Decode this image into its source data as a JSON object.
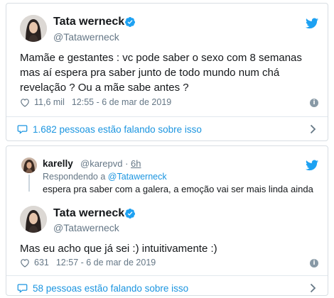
{
  "colors": {
    "link": "#1b95e0",
    "twitter_blue": "#1da1f2",
    "muted": "#657786",
    "text": "#14171a"
  },
  "tweet1": {
    "author_name": "Tata werneck",
    "author_handle": "@Tatawerneck",
    "text": "Mamãe e gestantes : vc pode saber o sexo com 8 semanas mas aí espera pra saber junto de todo mundo num chá revelação ? Ou a mãe sabe antes ?",
    "likes": "11,6 mil",
    "timestamp": "12:55 - 6 de mar de 2019",
    "talking": "1.682 pessoas estão falando sobre isso"
  },
  "reply_context": {
    "author_name": "karelly",
    "author_handle": "@karepvd",
    "time_ago": "6h",
    "replying_prefix": "Respondendo a",
    "replying_to": "@Tatawerneck",
    "text": "espera pra saber com a galera, a emoção vai ser mais linda ainda"
  },
  "tweet2": {
    "author_name": "Tata werneck",
    "author_handle": "@Tatawerneck",
    "text": "Mas eu acho que já sei :) intuitivamente :)",
    "likes": "631",
    "timestamp": "12:57 - 6 de mar de 2019",
    "talking": "58 pessoas estão falando sobre isso"
  },
  "icons": [
    "verified-badge-icon",
    "twitter-bird-icon",
    "heart-icon",
    "info-icon",
    "comment-bubble-icon",
    "chevron-right-icon"
  ]
}
